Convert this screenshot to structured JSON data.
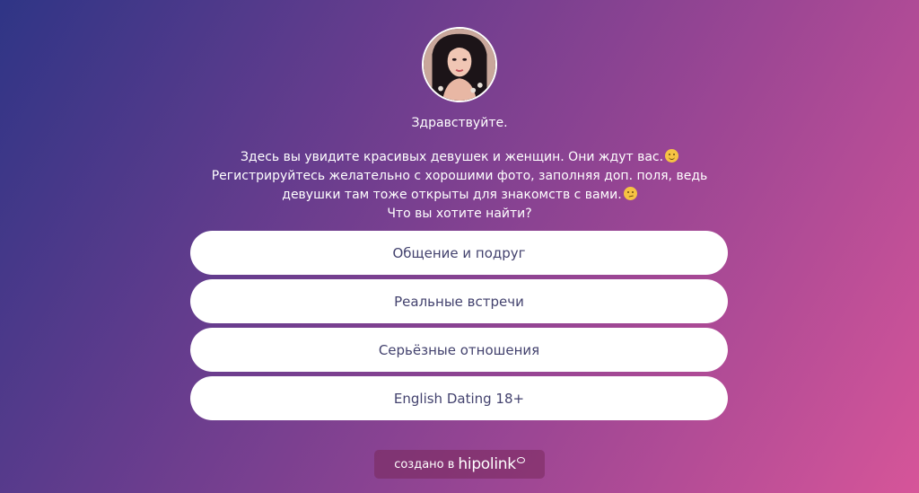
{
  "profile": {
    "avatar_alt": "profile photo"
  },
  "greeting": "Здравствуйте.",
  "description": {
    "line1": "Здесь вы увидите красивых девушек и женщин. Они ждут вас.",
    "line1_emoji": "smiling-face-icon",
    "line2": "Регистрируйтесь желательно с хорошими фото, заполняя доп. поля, ведь",
    "line3": "девушки там тоже открыты для знакомств с вами.",
    "line3_emoji": "thinking-face-icon",
    "line4": "Что вы хотите найти?"
  },
  "buttons": [
    {
      "label": "Общение и подруг"
    },
    {
      "label": "Реальные встречи"
    },
    {
      "label": "Серьёзные отношения"
    },
    {
      "label": "English Dating 18+"
    }
  ],
  "footer": {
    "prefix": "создано в",
    "brand": "hipolink"
  },
  "colors": {
    "gradient_start": "#2f3586",
    "gradient_end": "#d65599",
    "button_bg": "#ffffff",
    "button_text": "#43426e"
  }
}
